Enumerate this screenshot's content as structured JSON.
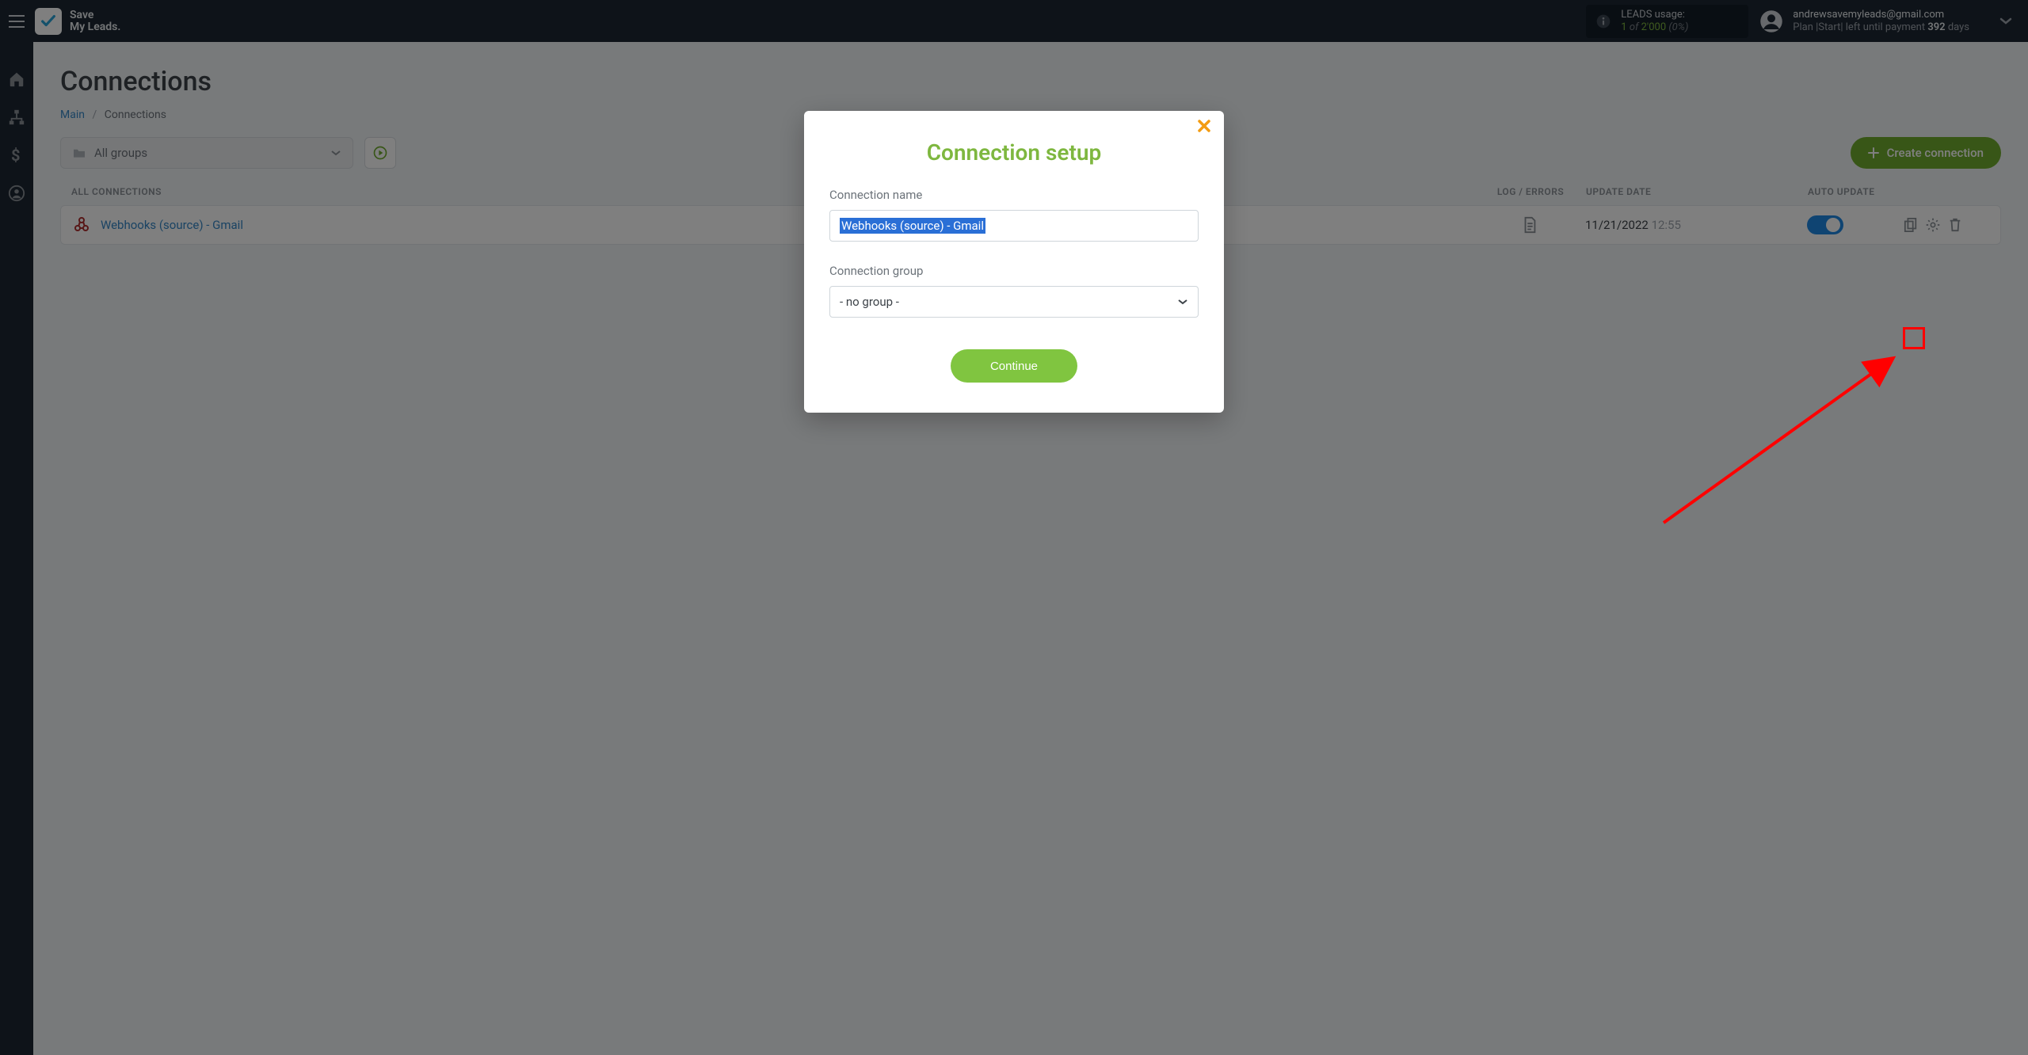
{
  "brand": {
    "line1": "Save",
    "line2": "My Leads."
  },
  "usage": {
    "label": "LEADS usage:",
    "current": "1",
    "of_word": "of",
    "total": "2'000",
    "pct": "(0%)"
  },
  "account": {
    "email": "andrewsavemyleads@gmail.com",
    "plan_prefix": "Plan |Start| left until payment ",
    "days_value": "392",
    "days_suffix": " days"
  },
  "page": {
    "title": "Connections",
    "breadcrumb_main": "Main",
    "breadcrumb_sep": "/",
    "breadcrumb_current": "Connections"
  },
  "toolbar": {
    "group_select": "All groups",
    "create_label": "Create connection"
  },
  "table": {
    "col_all": "ALL CONNECTIONS",
    "col_log": "LOG / ERRORS",
    "col_update": "UPDATE DATE",
    "col_auto": "AUTO UPDATE"
  },
  "rows": [
    {
      "name": "Webhooks (source) - Gmail",
      "date": "11/21/2022",
      "time": "12:55",
      "auto_update": true
    }
  ],
  "modal": {
    "title": "Connection setup",
    "name_label": "Connection name",
    "name_value": "Webhooks (source) - Gmail",
    "group_label": "Connection group",
    "group_value": "- no group -",
    "continue": "Continue"
  }
}
